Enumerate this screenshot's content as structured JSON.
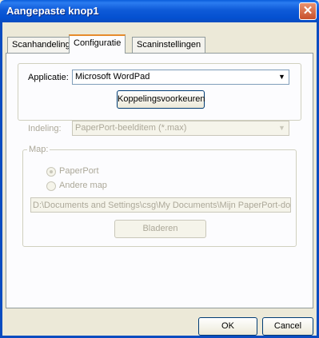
{
  "window": {
    "title": "Aangepaste knop1",
    "close_glyph": "✕",
    "accent_color": "#0a4cc0"
  },
  "tabs": [
    {
      "label": "Scanhandeling",
      "active": false
    },
    {
      "label": "Configuratie",
      "active": true
    },
    {
      "label": "Scaninstellingen",
      "active": false
    }
  ],
  "application": {
    "label": "Applicatie:",
    "value": "Microsoft WordPad",
    "button_label": "Koppelingsvoorkeuren"
  },
  "format": {
    "label": "Indeling:",
    "value": "PaperPort-beelditem (*.max)"
  },
  "folder": {
    "group_label": "Map:",
    "radio_paperport": "PaperPort",
    "radio_other": "Andere map",
    "selected": "PaperPort",
    "path": "D:\\Documents and Settings\\csg\\My Documents\\Mijn PaperPort-docu",
    "browse_label": "Bladeren"
  },
  "footer": {
    "ok_label": "OK",
    "cancel_label": "Cancel"
  },
  "icons": {
    "dropdown": "▼",
    "close": "close-icon"
  }
}
